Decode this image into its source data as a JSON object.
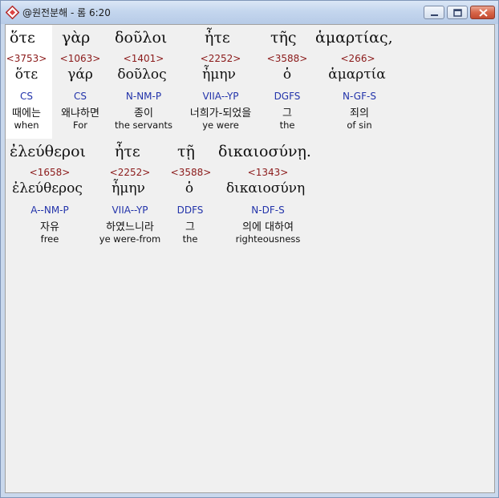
{
  "window": {
    "title": "@원전분해 - 롬 6:20",
    "controls": {
      "minimize_icon": "minimize-icon",
      "maximize_icon": "maximize-icon",
      "close_icon": "close-icon"
    }
  },
  "verse": {
    "row1": {
      "words": [
        "ὅτε",
        "γὰρ",
        "δοῦλοι",
        "ἦτε",
        "τῆς",
        "ἁμαρτίας,"
      ],
      "numbers": [
        "<3753>",
        "<1063>",
        "<1401>",
        "<2252>",
        "<3588>",
        "<266>"
      ],
      "lemmas": [
        "ὅτε",
        "γάρ",
        "δοῦλος",
        "ἦμην",
        "ὁ",
        "ἁμαρτία"
      ],
      "parsing": [
        "CS",
        "CS",
        "N-NM-P",
        "VIIA--YP",
        "DGFS",
        "N-GF-S"
      ],
      "korean": [
        "때에는",
        "왜냐하면",
        "종이",
        "너희가-되었을",
        "그",
        "죄의"
      ],
      "english": [
        "when",
        "For",
        "the servants",
        "ye were",
        "the",
        "of sin"
      ]
    },
    "row2": {
      "words": [
        "ἐλεύθεροι",
        "ἦτε",
        "τῇ",
        "δικαιοσύνῃ."
      ],
      "numbers": [
        "<1658>",
        "<2252>",
        "<3588>",
        "<1343>"
      ],
      "lemmas": [
        "ἐλεύθερος",
        "ἦμην",
        "ὁ",
        "δικαιοσύνη"
      ],
      "parsing": [
        "A--NM-P",
        "VIIA--YP",
        "DDFS",
        "N-DF-S"
      ],
      "korean": [
        "자유",
        "하였느니라",
        "그",
        "의에 대하여"
      ],
      "english": [
        "free",
        "ye were-from",
        "the",
        "righteousness"
      ]
    }
  },
  "colors": {
    "number": "#8b1a1a",
    "parsing": "#2233aa",
    "highlight": "#ffffff"
  }
}
